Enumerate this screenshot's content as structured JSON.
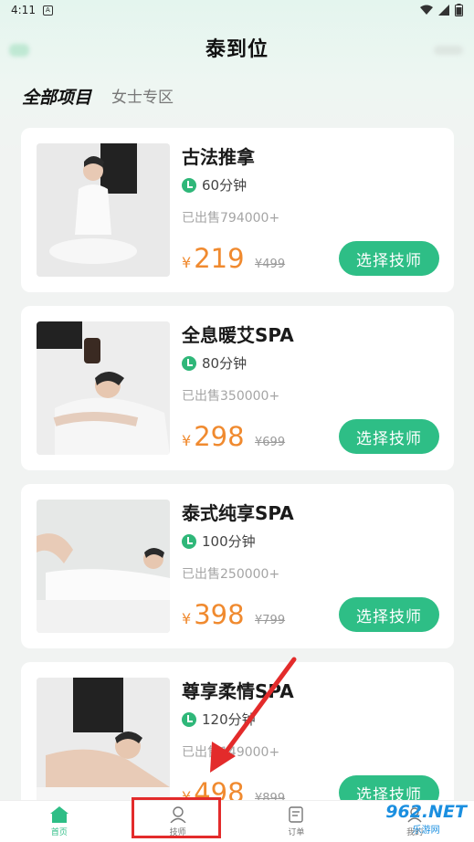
{
  "status_bar": {
    "time": "4:11",
    "notif_icon": "A"
  },
  "header": {
    "title": "泰到位"
  },
  "tabs": [
    {
      "label": "全部项目",
      "active": true
    },
    {
      "label": "女士专区",
      "active": false
    }
  ],
  "services": [
    {
      "title": "古法推拿",
      "duration": "60分钟",
      "sold": "已出售794000+",
      "currency": "¥",
      "price": "219",
      "original_price": "¥499",
      "button": "选择技师"
    },
    {
      "title": "全息暖艾SPA",
      "duration": "80分钟",
      "sold": "已出售350000+",
      "currency": "¥",
      "price": "298",
      "original_price": "¥699",
      "button": "选择技师"
    },
    {
      "title": "泰式纯享SPA",
      "duration": "100分钟",
      "sold": "已出售250000+",
      "currency": "¥",
      "price": "398",
      "original_price": "¥799",
      "button": "选择技师"
    },
    {
      "title": "尊享柔情SPA",
      "duration": "120分钟",
      "sold": "已出售149000+",
      "currency": "¥",
      "price": "498",
      "original_price": "¥899",
      "button": "选择技师"
    }
  ],
  "tabbar": [
    {
      "label": "首页",
      "icon": "home-icon",
      "active": true
    },
    {
      "label": "技师",
      "icon": "user-icon",
      "active": false
    },
    {
      "label": "订单",
      "icon": "order-icon",
      "active": false
    },
    {
      "label": "我的",
      "icon": "profile-icon",
      "active": false
    }
  ],
  "watermark": {
    "big": "962.NET",
    "small": "乐游网"
  },
  "colors": {
    "accent": "#2ebe86",
    "price": "#f08a2f",
    "annotation": "#e32b2b"
  }
}
